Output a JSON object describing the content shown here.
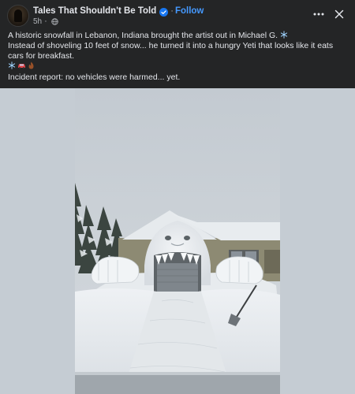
{
  "post": {
    "page_name": "Tales That Shouldn't Be Told",
    "follow_label": "Follow",
    "time_ago": "5h",
    "separator": "·",
    "icons": {
      "avatar": "avatar",
      "verified": "verified-badge-icon",
      "audience": "globe-icon",
      "more": "more-options-icon",
      "close": "close-icon"
    },
    "text": {
      "line1": "A historic snowfall in Lebanon, Indiana brought the artist out in Michael G.",
      "line2": "Instead of shoveling 10 feet of snow... he turned it into a hungry Yeti that looks like it eats cars for breakfast.",
      "line4": "Incident report: no vehicles were harmed... yet."
    },
    "emojis": [
      "snowflake",
      "car",
      "fire"
    ],
    "media": {
      "subject": "snow-yeti-sculpture-photo"
    },
    "colors": {
      "background": "#242526",
      "text": "#e4e6eb",
      "secondary_text": "#b0b3b8",
      "follow": "#4599ff",
      "verified": "#1877f2"
    }
  }
}
